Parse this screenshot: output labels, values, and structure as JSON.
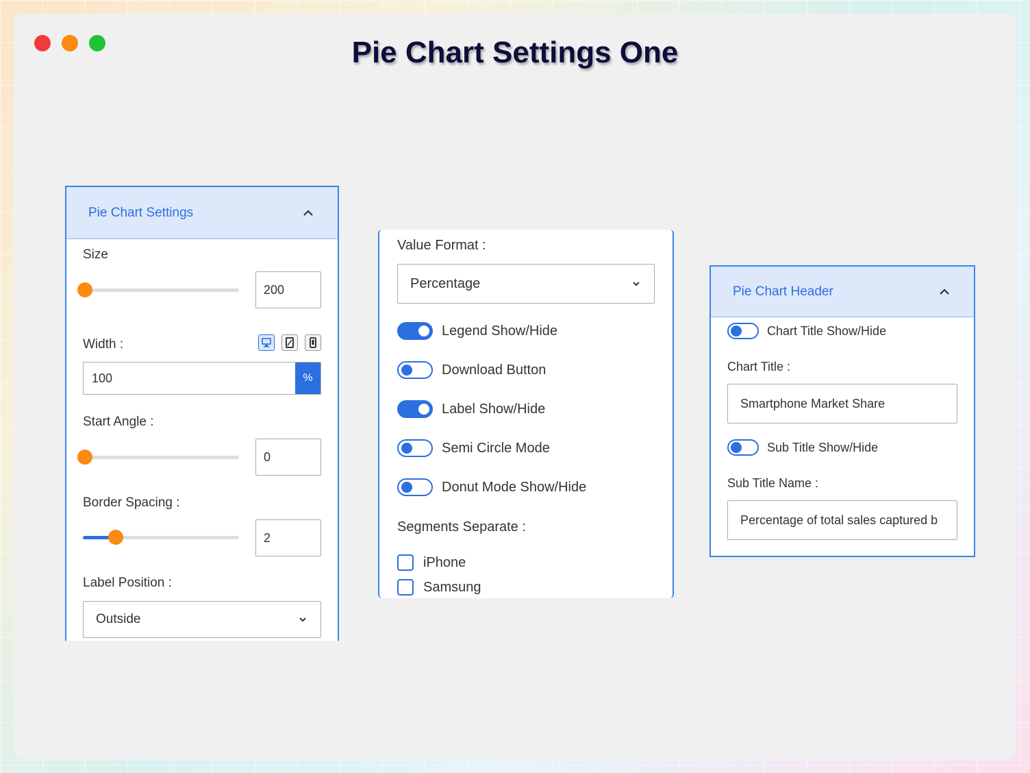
{
  "window": {
    "title": "Pie Chart Settings One"
  },
  "settings_panel": {
    "header": "Pie Chart Settings",
    "size_label": "Size",
    "size_value": "200",
    "size_slider_level": 0.0,
    "width_label": "Width :",
    "width_value": "100",
    "width_unit": "%",
    "device_icons": [
      "desktop-icon",
      "tablet-icon",
      "mobile-icon"
    ],
    "start_angle_label": "Start Angle :",
    "start_angle_value": "0",
    "start_angle_slider_level": 0.0,
    "border_spacing_label": "Border Spacing :",
    "border_spacing_value": "2",
    "border_spacing_slider_level": 0.2,
    "label_position_label": "Label Position :",
    "label_position_value": "Outside"
  },
  "format_panel": {
    "value_format_label": "Value Format :",
    "value_format_value": "Percentage",
    "toggles": [
      {
        "label": "Legend Show/Hide",
        "on": true
      },
      {
        "label": "Download Button",
        "on": false
      },
      {
        "label": "Label Show/Hide",
        "on": true
      },
      {
        "label": "Semi Circle Mode",
        "on": false
      },
      {
        "label": "Donut Mode Show/Hide",
        "on": false
      }
    ],
    "segments_label": "Segments Separate :",
    "segments": [
      {
        "label": "iPhone",
        "checked": false
      },
      {
        "label": "Samsung",
        "checked": false
      }
    ]
  },
  "header_panel": {
    "header": "Pie Chart Header",
    "chart_title_toggle": "Chart Title Show/Hide",
    "chart_title_label": "Chart Title :",
    "chart_title_value": "Smartphone Market Share",
    "sub_title_toggle": "Sub Title Show/Hide",
    "sub_title_label": "Sub Title Name :",
    "sub_title_value": "Percentage of total sales captured b"
  },
  "colors": {
    "accent": "#2c6fe0",
    "slider_thumb": "#fb8a10",
    "title": "#0e0e3c"
  }
}
